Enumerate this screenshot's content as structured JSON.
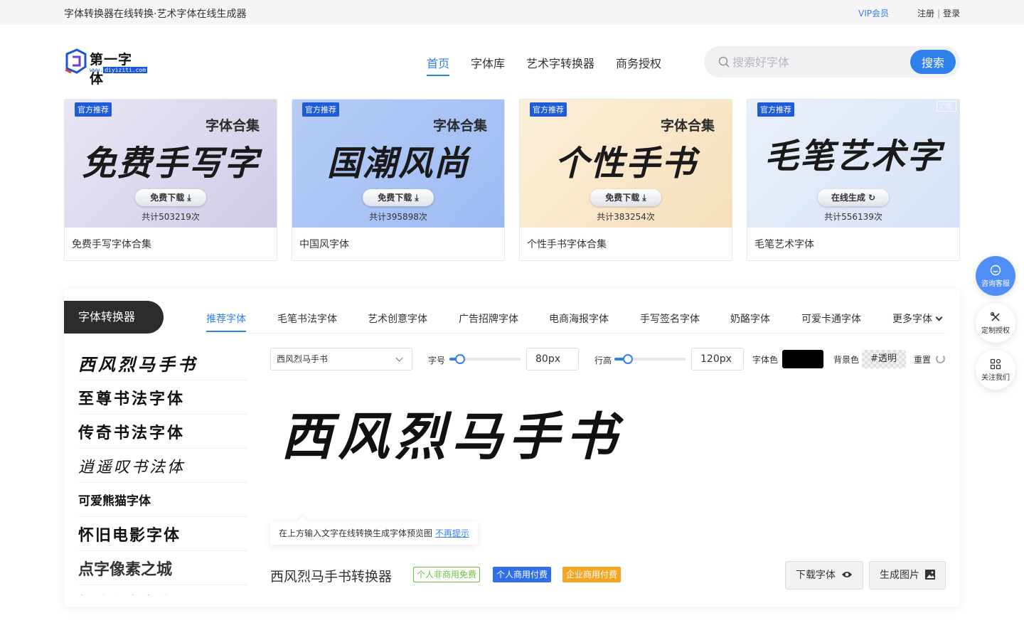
{
  "topbar": {
    "site_title": "字体转换器在线转换·艺术字体在线生成器",
    "vip": "VIP会员",
    "register": "注册",
    "divider": "|",
    "login": "登录"
  },
  "logo": {
    "name": "第一字体",
    "url_prefix": "www.",
    "url_domain": "diyiziti.com"
  },
  "nav": [
    "首页",
    "字体库",
    "艺术字转换器",
    "商务授权"
  ],
  "search": {
    "placeholder": "搜索好字体",
    "button": "搜索"
  },
  "cards": [
    {
      "tag": "官方推荐",
      "subtitle": "字体合集",
      "headline": "免费手写字",
      "button": "免费下载 ⤓",
      "count": "共计503219次",
      "caption": "免费手写字体合集",
      "bg": "#dcd8ee"
    },
    {
      "tag": "官方推荐",
      "subtitle": "字体合集",
      "headline": "国潮风尚",
      "button": "免费下载 ⤓",
      "count": "共计395898次",
      "caption": "中国风字体",
      "bg": "#a9c3f5"
    },
    {
      "tag": "官方推荐",
      "subtitle": "字体合集",
      "headline": "个性手书",
      "button": "免费下载 ⤓",
      "count": "共计383254次",
      "caption": "个性手书字体合集",
      "bg": "#f8e6c8"
    },
    {
      "tag": "官方推荐",
      "ad": "广告",
      "subtitle": "",
      "headline": "毛笔艺术字",
      "button": "在线生成 ↻",
      "count": "共计556139次",
      "caption": "毛笔艺术字体",
      "bg": "#dfe8f8"
    }
  ],
  "converter": {
    "title": "字体转换器",
    "tabs": [
      "推荐字体",
      "毛笔书法字体",
      "艺术创意字体",
      "广告招牌字体",
      "电商海报字体",
      "手写签名字体",
      "奶酪字体",
      "可爱卡通字体",
      "更多字体"
    ],
    "fonts": [
      "西风烈马手书",
      "至尊书法字体",
      "传奇书法字体",
      "逍遥叹书法体",
      "可爱熊猫字体",
      "怀旧电影字体",
      "点字像素之城",
      "趣味创意字体"
    ],
    "selected_font": "西风烈马手书",
    "size_label": "字号",
    "size_value": "80px",
    "size_level": 0.08,
    "line_label": "行高",
    "line_value": "120px",
    "line_level": 0.12,
    "color_label": "字体色",
    "color_value": "#000000",
    "bg_label": "背景色",
    "bg_value": "#透明",
    "reset_label": "重置",
    "preview_text": "西风烈马手书",
    "tip_text": "在上方输入文字在线转换生成字体预览图",
    "tip_link": "不再提示",
    "page_title": "西风烈马手书转换器",
    "badges": [
      "个人非商用免费",
      "个人商用付费",
      "企业商用付费"
    ],
    "download": "下载字体",
    "generate": "生成图片"
  },
  "floating": [
    "咨询客服",
    "定制授权",
    "关注我们"
  ],
  "colors": {
    "accent": "#2f80ed",
    "dark": "#2c2c2c",
    "free": "#67c23a",
    "enterprise": "#f5a623"
  }
}
